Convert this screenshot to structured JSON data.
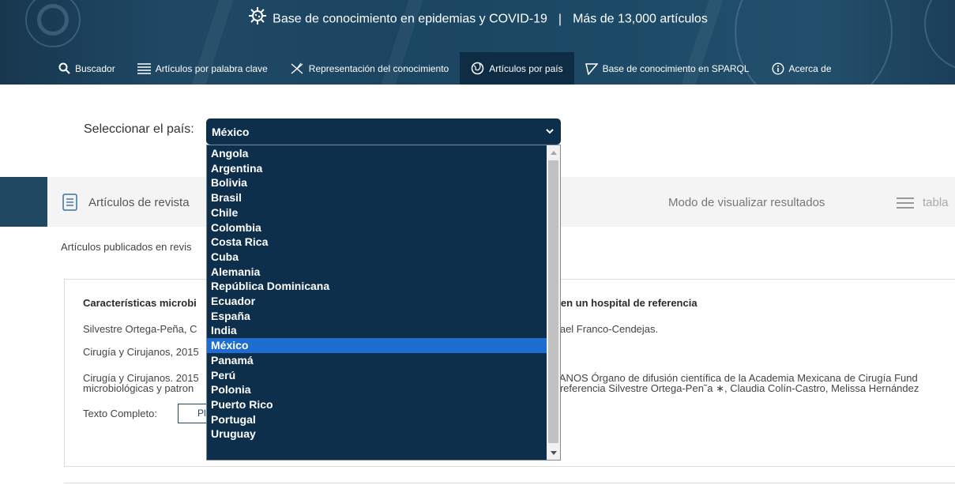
{
  "header": {
    "title": "Base de conocimiento en epidemias y COVID-19",
    "separator": "|",
    "count": "Más de 13,000 artículos",
    "nav": [
      {
        "label": "Buscador",
        "icon": "search-icon"
      },
      {
        "label": "Artículos por palabra clave",
        "icon": "list-icon"
      },
      {
        "label": "Representación del conocimiento",
        "icon": "graph-icon"
      },
      {
        "label": "Artículos por país",
        "icon": "globe-icon",
        "active": true
      },
      {
        "label": "Base de conocimiento en SPARQL",
        "icon": "triangle-icon"
      },
      {
        "label": "Acerca de",
        "icon": "info-icon"
      }
    ]
  },
  "country": {
    "label": "Seleccionar el país:",
    "selected": "México",
    "options": [
      "Angola",
      "Argentina",
      "Bolivia",
      "Brasil",
      "Chile",
      "Colombia",
      "Costa Rica",
      "Cuba",
      "Alemania",
      "República Dominicana",
      "Ecuador",
      "España",
      "India",
      "México",
      "Panamá",
      "Perú",
      "Polonia",
      "Puerto Rico",
      "Portugal",
      "Uruguay"
    ]
  },
  "section": {
    "title": "Artículos de revista",
    "mode_label": "Modo de visualizar resultados",
    "view_label": "tabla"
  },
  "published_text": "Artículos publicados en revis",
  "article": {
    "title_start": "Características microbi",
    "title_end": "ar en un hospital de referencia",
    "authors_start": "Silvestre Ortega-Peña, C",
    "authors_end": "afael Franco-Cendejas.",
    "journal": "Cirugía y Cirujanos, 2015",
    "abstract_1_start": "Cirugía y Cirujanos. 2015",
    "abstract_1_end": "UJANOS Órgano de difusión científica de la Academia Mexicana de Cirugía Fund",
    "abstract_2_start": "microbiológicas y patron",
    "abstract_2_end": "e referencia Silvestre Ortega-Pen˜a ∗, Claudia Colín-Castro, Melissa Hernández",
    "fulltext_label": "Texto Completo:",
    "pdf_label": "Pl"
  },
  "colors": {
    "header_bg": "#1d4a66",
    "select_bg": "#0d2f4b",
    "selected_option": "#1e6dd0",
    "section_accent": "#1f4963"
  }
}
